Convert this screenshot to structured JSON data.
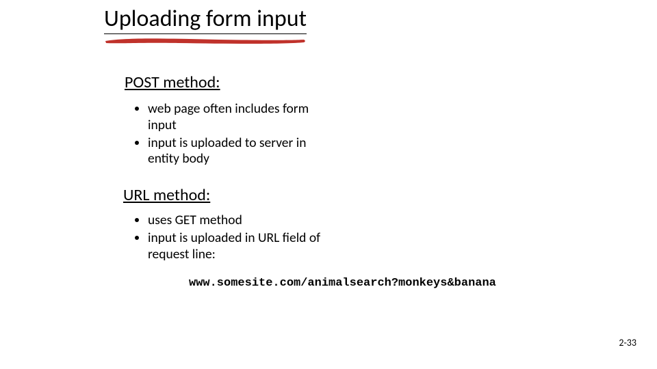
{
  "title": "Uploading form input",
  "section1": {
    "heading": "POST method:",
    "bullets": [
      "web page often includes form input",
      "input is uploaded to server in entity body"
    ]
  },
  "section2": {
    "heading": "URL method:",
    "bullets": [
      "uses GET method",
      "input is uploaded in URL field of request line:"
    ]
  },
  "example_url": "www.somesite.com/animalsearch?monkeys&banana",
  "page_number": "2-33"
}
